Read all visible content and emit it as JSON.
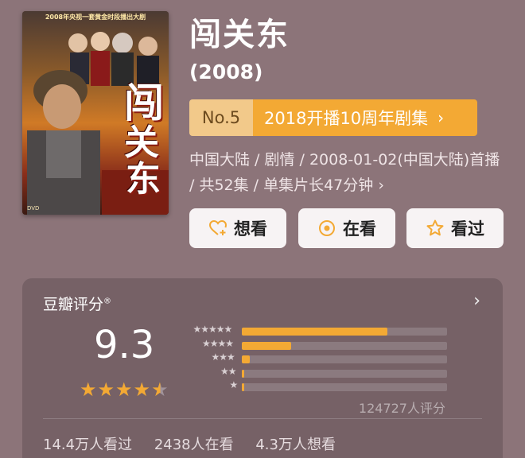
{
  "poster": {
    "caption_line1": "2008年央视一套黄金时段播出大剧",
    "glyphs": [
      "闯",
      "关",
      "东"
    ]
  },
  "title": "闯关东",
  "year": "(2008)",
  "rank": {
    "number": "No.5",
    "label": "2018开播10周年剧集",
    "chevron": "›"
  },
  "meta": "中国大陆 / 剧情 / 2008-01-02(中国大陆)首播 / 共52集 / 单集片长47分钟 ›",
  "buttons": {
    "want": "想看",
    "watching": "在看",
    "watched": "看过"
  },
  "rating": {
    "title": "豆瓣评分",
    "registered": "®",
    "chevron": "›",
    "score": "9.3",
    "stars": 4.5,
    "distribution": [
      {
        "stars": "★★★★★",
        "fraction": 0.71
      },
      {
        "stars": "★★★★",
        "fraction": 0.24
      },
      {
        "stars": "★★★",
        "fraction": 0.04
      },
      {
        "stars": "★★",
        "fraction": 0.005
      },
      {
        "stars": "★",
        "fraction": 0.003
      }
    ],
    "count": "124727人评分"
  },
  "stats": {
    "watched": "14.4万人看过",
    "watching": "2438人在看",
    "want": "4.3万人想看"
  },
  "colors": {
    "background": "#8c7479",
    "accent": "#f3a934",
    "rank_no_bg": "#f2c98a",
    "card_bg": "#766166"
  },
  "icons": {
    "want": "heart-plus-icon",
    "watching": "target-circle-icon",
    "watched": "star-outline-icon"
  }
}
